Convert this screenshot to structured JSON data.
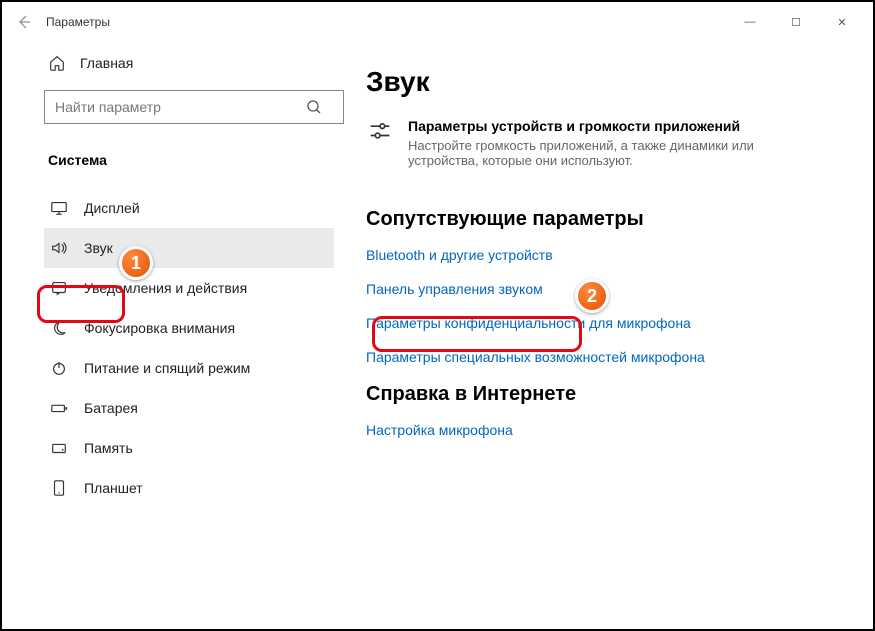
{
  "window": {
    "title": "Параметры"
  },
  "winControls": {
    "min": "—",
    "max": "☐",
    "close": "✕"
  },
  "sidebar": {
    "home": "Главная",
    "searchPlaceholder": "Найти параметр",
    "section": "Система",
    "items": [
      {
        "label": "Дисплей"
      },
      {
        "label": "Звук"
      },
      {
        "label": "Уведомления и действия"
      },
      {
        "label": "Фокусировка внимания"
      },
      {
        "label": "Питание и спящий режим"
      },
      {
        "label": "Батарея"
      },
      {
        "label": "Память"
      },
      {
        "label": "Планшет"
      }
    ]
  },
  "content": {
    "title": "Звук",
    "vol": {
      "title": "Параметры устройств и громкости приложений",
      "desc": "Настройте громкость приложений, а также динамики или устройства, которые они используют."
    },
    "related": {
      "heading": "Сопутствующие параметры",
      "links": [
        "Bluetooth и другие устройств",
        "Панель управления звуком",
        "Параметры конфиденциальности для микрофона",
        "Параметры специальных возможностей микрофона"
      ]
    },
    "help": {
      "heading": "Справка в Интернете",
      "links": [
        "Настройка микрофона"
      ]
    }
  },
  "callouts": [
    "1",
    "2"
  ]
}
